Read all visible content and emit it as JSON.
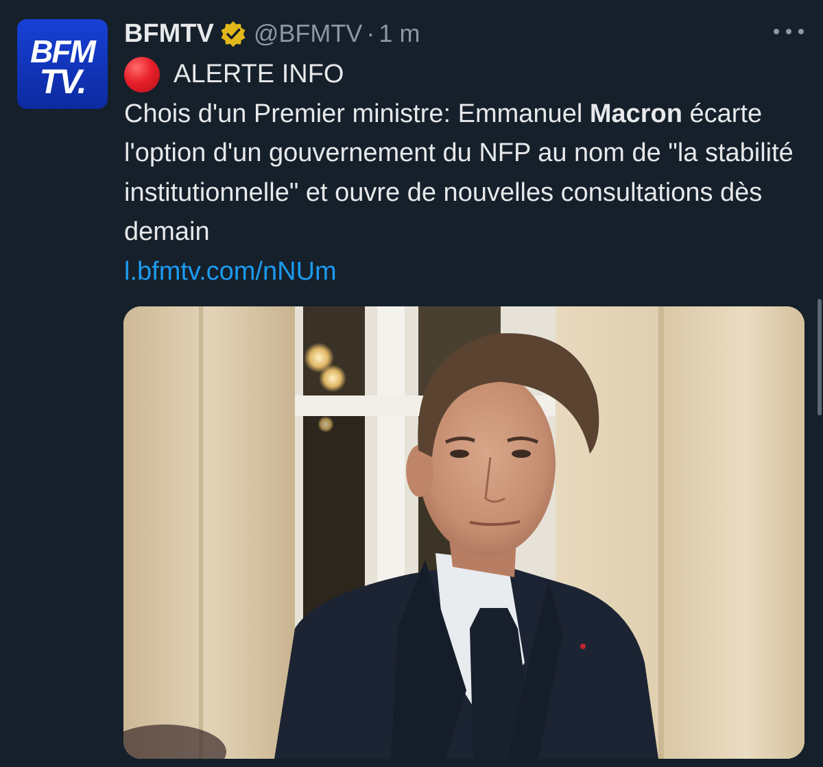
{
  "tweet": {
    "avatar": {
      "line1": "BFM",
      "line2": "TV."
    },
    "author": {
      "display_name": "BFMTV",
      "handle": "@BFMTV",
      "separator": "·",
      "time": "1 m",
      "verified_icon": "verified-badge-icon"
    },
    "more_icon": "more-options-icon",
    "alert_icon": "red-circle-emoji",
    "alert_text": "ALERTE INFO",
    "text_part1": "Chois d'un Premier ministre: Emmanuel ",
    "text_bold": "Macron",
    "text_part2": " écarte l'option d'un gouvernement du NFP au nom de \"la stabilité institutionnelle\" et ouvre de nouvelles consultations dès demain",
    "link": "l.bfmtv.com/nNUm"
  },
  "colors": {
    "background": "#15202b",
    "text": "#e7e9ea",
    "muted": "#8b98a5",
    "link": "#1d9bf0",
    "verified_gold": "#e2b719",
    "avatar_blue": "#1741d6"
  }
}
